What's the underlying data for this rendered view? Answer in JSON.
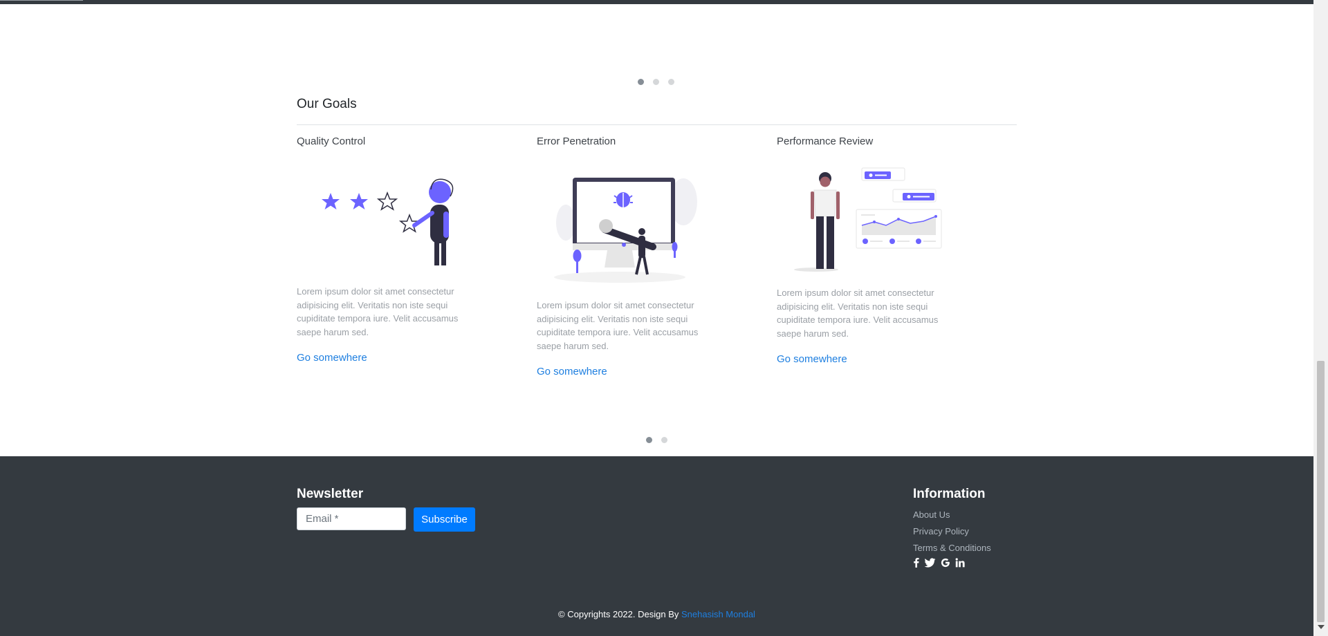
{
  "carousel_top": {
    "slides": 3,
    "active": 1
  },
  "goals": {
    "title": "Our Goals",
    "cards": [
      {
        "title": "Quality Control",
        "illustration": "rating-stars-illustration",
        "text": "Lorem ipsum dolor sit amet consectetur adipisicing elit. Veritatis non iste sequi cupiditate tempora iure. Velit accusamus saepe harum sed.",
        "link": "Go somewhere"
      },
      {
        "title": "Error Penetration",
        "illustration": "bug-fixing-illustration",
        "text": "Lorem ipsum dolor sit amet consectetur adipisicing elit. Veritatis non iste sequi cupiditate tempora iure. Velit accusamus saepe harum sed.",
        "link": "Go somewhere"
      },
      {
        "title": "Performance Review",
        "illustration": "analytics-dashboard-illustration",
        "text": "Lorem ipsum dolor sit amet consectetur adipisicing elit. Veritatis non iste sequi cupiditate tempora iure. Velit accusamus saepe harum sed.",
        "link": "Go somewhere"
      }
    ]
  },
  "carousel_bottom": {
    "slides": 2,
    "active": 1
  },
  "footer": {
    "newsletter": {
      "title": "Newsletter",
      "email_placeholder": "Email *",
      "subscribe_label": "Subscribe"
    },
    "information": {
      "title": "Information",
      "links": [
        "About Us",
        "Privacy Policy",
        "Terms & Conditions"
      ],
      "social": [
        "facebook-icon",
        "twitter-icon",
        "google-icon",
        "linkedin-icon"
      ]
    },
    "copyright": {
      "prefix": "© Copyrights 2022. Design By ",
      "author": "Snehasish Mondal"
    }
  },
  "colors": {
    "accent": "#6c63ff",
    "link": "#1e7fe0",
    "footer_bg": "#343a40",
    "button": "#007bff"
  }
}
